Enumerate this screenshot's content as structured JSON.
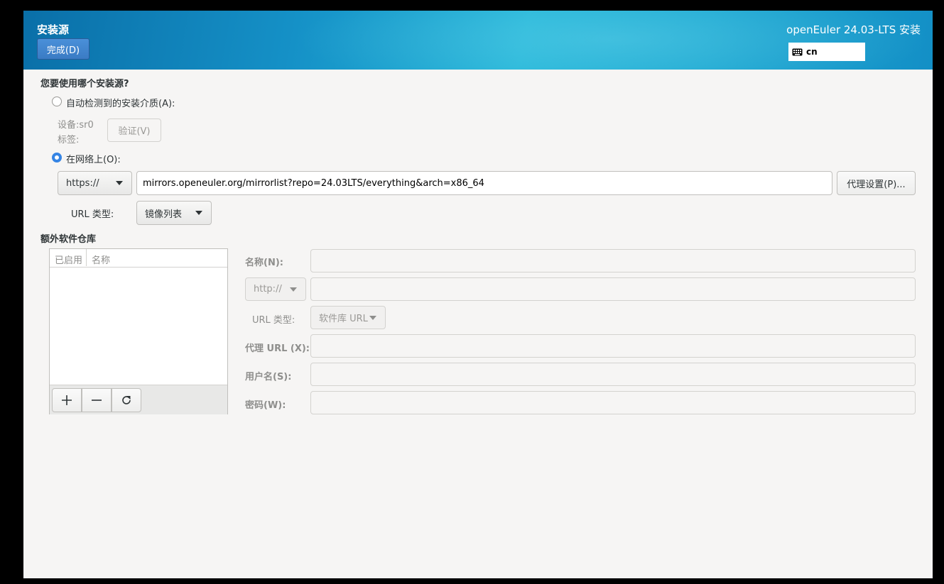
{
  "header": {
    "spoke_title": "安装源",
    "done_button": "完成(D)",
    "product_title": "openEuler 24.03-LTS 安装",
    "keyboard_layout": "cn"
  },
  "source": {
    "question": "您要使用哪个安装源?",
    "auto_detect_label": "自动检测到的安装介质(A):",
    "device_label": "设备:",
    "device_value": "sr0",
    "tag_label": "标签:",
    "verify_button": "验证(V)",
    "network_label": "在网络上(O):",
    "network_selected": true,
    "protocol": "https://",
    "url": "mirrors.openeuler.org/mirrorlist?repo=24.03LTS/everything&arch=x86_64",
    "proxy_button": "代理设置(P)...",
    "url_type_label": "URL 类型:",
    "url_type_value": "镜像列表"
  },
  "extra_repos": {
    "title": "额外软件仓库",
    "columns": [
      "已启用",
      "名称"
    ],
    "rows": [],
    "form": {
      "name_label": "名称(N):",
      "name_value": "",
      "protocol": "http://",
      "url_value": "",
      "url_type_label": "URL 类型:",
      "url_type_value": "软件库 URL",
      "proxy_url_label": "代理 URL (X):",
      "proxy_url_value": "",
      "username_label": "用户名(S):",
      "username_value": "",
      "password_label": "密码(W):",
      "password_value": ""
    }
  },
  "colors": {
    "accent": "#3584e4",
    "header_start": "#0a6fa8",
    "header_mid": "#27b7d9",
    "window_bg": "#f6f5f4"
  }
}
